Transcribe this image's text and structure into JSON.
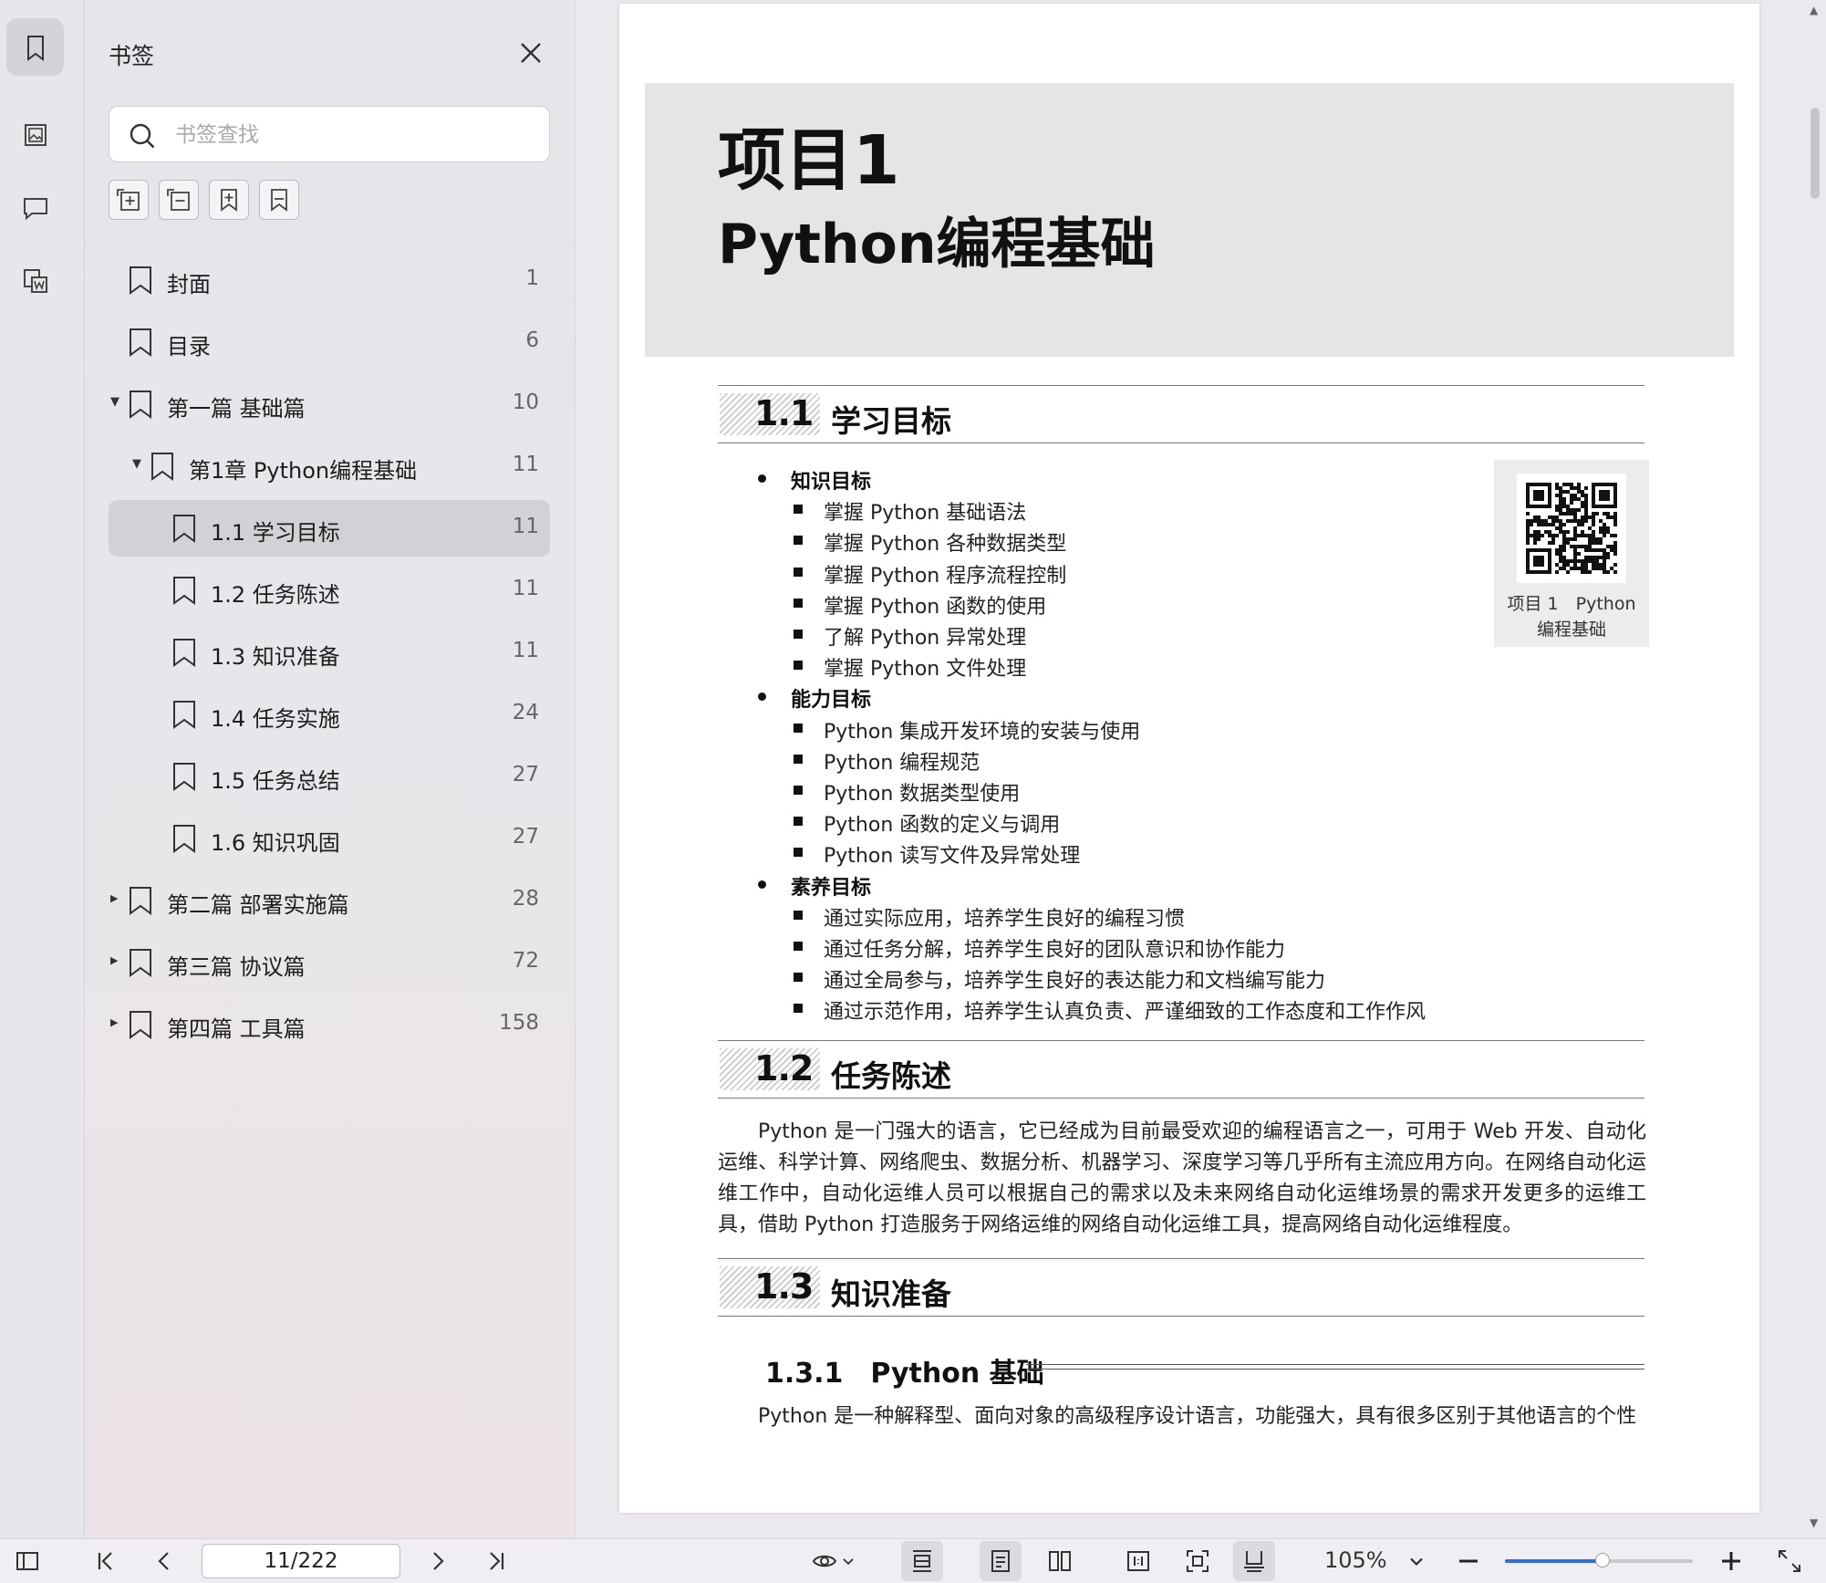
{
  "panel": {
    "title": "书签",
    "search_placeholder": "书签查找",
    "tools": [
      "expand-all-icon",
      "collapse-all-icon",
      "add-bookmark-icon",
      "bookmark-outline-icon"
    ],
    "bookmarks": [
      {
        "label": "封面",
        "page": "1",
        "level": 0,
        "arrow": "",
        "selected": false
      },
      {
        "label": "目录",
        "page": "6",
        "level": 0,
        "arrow": "",
        "selected": false
      },
      {
        "label": "第一篇 基础篇",
        "page": "10",
        "level": 0,
        "arrow": "▼",
        "selected": false
      },
      {
        "label": "第1章 Python编程基础",
        "page": "11",
        "level": 1,
        "arrow": "▼",
        "selected": false
      },
      {
        "label": "1.1 学习目标",
        "page": "11",
        "level": 2,
        "arrow": "",
        "selected": true
      },
      {
        "label": "1.2 任务陈述",
        "page": "11",
        "level": 2,
        "arrow": "",
        "selected": false
      },
      {
        "label": "1.3 知识准备",
        "page": "11",
        "level": 2,
        "arrow": "",
        "selected": false
      },
      {
        "label": "1.4 任务实施",
        "page": "24",
        "level": 2,
        "arrow": "",
        "selected": false
      },
      {
        "label": "1.5 任务总结",
        "page": "27",
        "level": 2,
        "arrow": "",
        "selected": false
      },
      {
        "label": "1.6 知识巩固",
        "page": "27",
        "level": 2,
        "arrow": "",
        "selected": false
      },
      {
        "label": "第二篇 部署实施篇",
        "page": "28",
        "level": 0,
        "arrow": "▶",
        "selected": false
      },
      {
        "label": "第三篇 协议篇",
        "page": "72",
        "level": 0,
        "arrow": "▶",
        "selected": false
      },
      {
        "label": "第四篇 工具篇",
        "page": "158",
        "level": 0,
        "arrow": "▶",
        "selected": false
      }
    ]
  },
  "document": {
    "project_no": "项目1",
    "project_name": "Python编程基础",
    "sec11": {
      "num": "1.1",
      "title": "学习目标"
    },
    "goals": [
      {
        "head": "知识目标",
        "items": [
          "掌握 Python 基础语法",
          "掌握 Python 各种数据类型",
          "掌握 Python 程序流程控制",
          "掌握 Python 函数的使用",
          "了解 Python 异常处理",
          "掌握 Python 文件处理"
        ]
      },
      {
        "head": "能力目标",
        "items": [
          "Python 集成开发环境的安装与使用",
          "Python 编程规范",
          "Python 数据类型使用",
          "Python 函数的定义与调用",
          "Python 读写文件及异常处理"
        ]
      },
      {
        "head": "素养目标",
        "items": [
          "通过实际应用，培养学生良好的编程习惯",
          "通过任务分解，培养学生良好的团队意识和协作能力",
          "通过全局参与，培养学生良好的表达能力和文档编写能力",
          "通过示范作用，培养学生认真负责、严谨细致的工作态度和工作作风"
        ]
      }
    ],
    "qr_caption_1": "项目 1　Python",
    "qr_caption_2": "编程基础",
    "sec12": {
      "num": "1.2",
      "title": "任务陈述"
    },
    "para12": "Python 是一门强大的语言，它已经成为目前最受欢迎的编程语言之一，可用于 Web 开发、自动化运维、科学计算、网络爬虫、数据分析、机器学习、深度学习等几乎所有主流应用方向。在网络自动化运维工作中，自动化运维人员可以根据自己的需求以及未来网络自动化运维场景的需求开发更多的运维工具，借助 Python 打造服务于网络运维的网络自动化运维工具，提高网络自动化运维程度。",
    "sec13": {
      "num": "1.3",
      "title": "知识准备"
    },
    "sub131": "1.3.1　Python 基础",
    "para131": "Python 是一种解释型、面向对象的高级程序设计语言，功能强大，具有很多区别于其他语言的个性"
  },
  "toolbar": {
    "page_value": "11/222",
    "zoom": "105%",
    "zoom_fraction": 0.52
  }
}
